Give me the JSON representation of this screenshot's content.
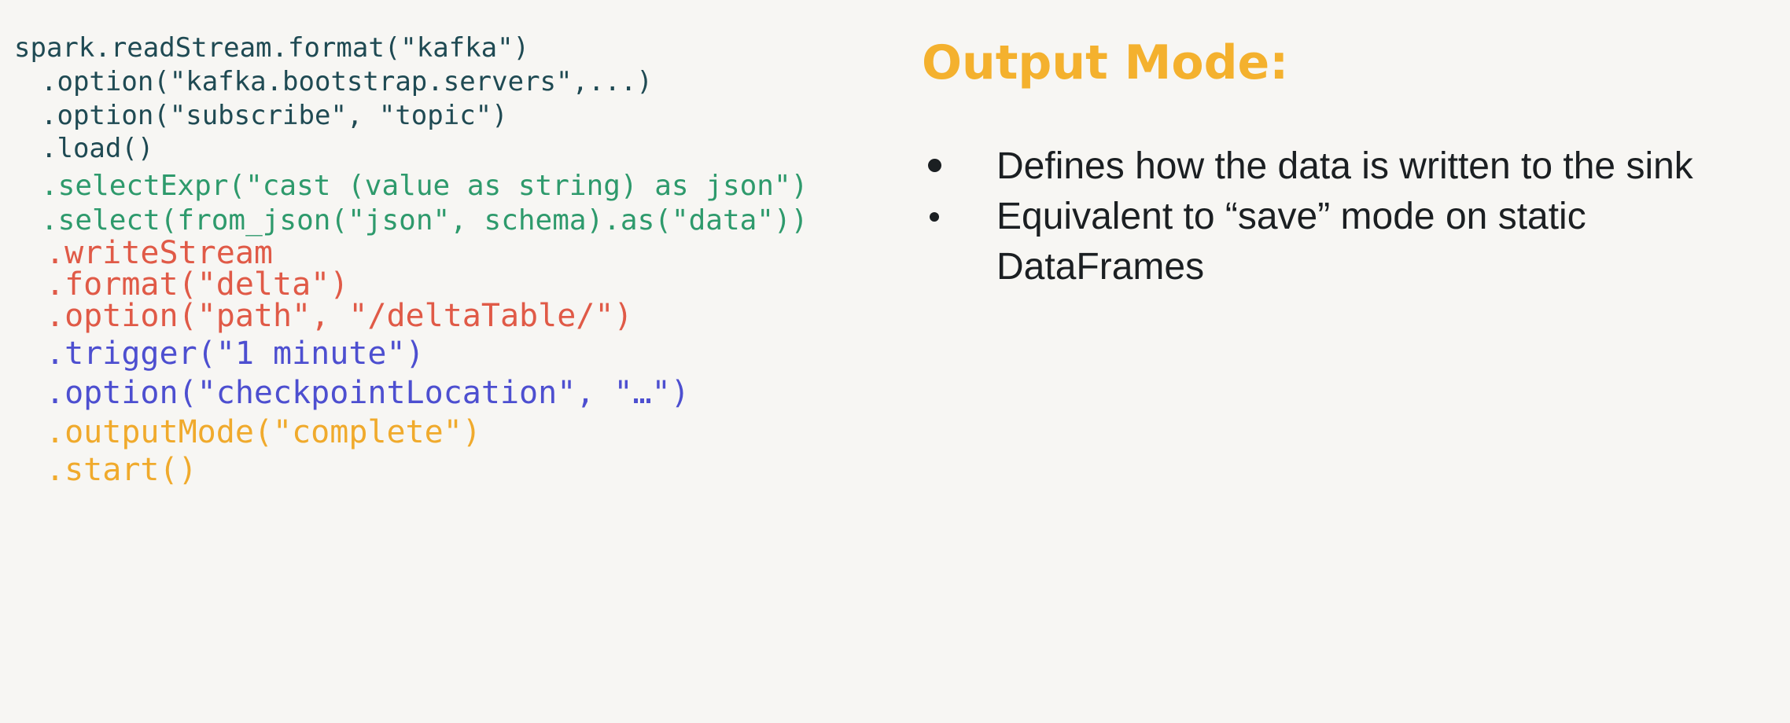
{
  "colors": {
    "background": "#f7f6f3",
    "code_dark": "#1f4a53",
    "code_green": "#2e9a6c",
    "code_red": "#e05a47",
    "code_blue": "#4d4fd0",
    "code_orange": "#f0aa2c",
    "title_orange": "#f4b12e",
    "bullet_text": "#1b1f22"
  },
  "code": {
    "lines": [
      {
        "text": "spark.readStream.format(\"kafka\")",
        "color": "#1f4a53"
      },
      {
        "text": ".option(\"kafka.bootstrap.servers\",...)",
        "color": "#1f4a53"
      },
      {
        "text": ".option(\"subscribe\", \"topic\")",
        "color": "#1f4a53"
      },
      {
        "text": ".load()",
        "color": "#1f4a53"
      },
      {
        "text": ".selectExpr(\"cast (value as string) as json\")",
        "color": "#2e9a6c"
      },
      {
        "text": ".select(from_json(\"json\", schema).as(\"data\"))",
        "color": "#2e9a6c"
      },
      {
        "text": ".writeStream",
        "color": "#e05a47"
      },
      {
        "text": ".format(\"delta\")",
        "color": "#e05a47"
      },
      {
        "text": ".option(\"path\", \"/deltaTable/\")",
        "color": "#e05a47"
      },
      {
        "text": ".trigger(\"1 minute\")",
        "color": "#4d4fd0"
      },
      {
        "text": ".option(\"checkpointLocation\", \"…\")",
        "color": "#4d4fd0"
      },
      {
        "text": ".outputMode(\"complete\")",
        "color": "#f0aa2c"
      },
      {
        "text": ".start()",
        "color": "#f0aa2c"
      }
    ]
  },
  "title": "Output Mode:",
  "bullets": [
    "Defines how the data is written to the sink",
    "Equivalent to “save” mode on static DataFrames"
  ]
}
